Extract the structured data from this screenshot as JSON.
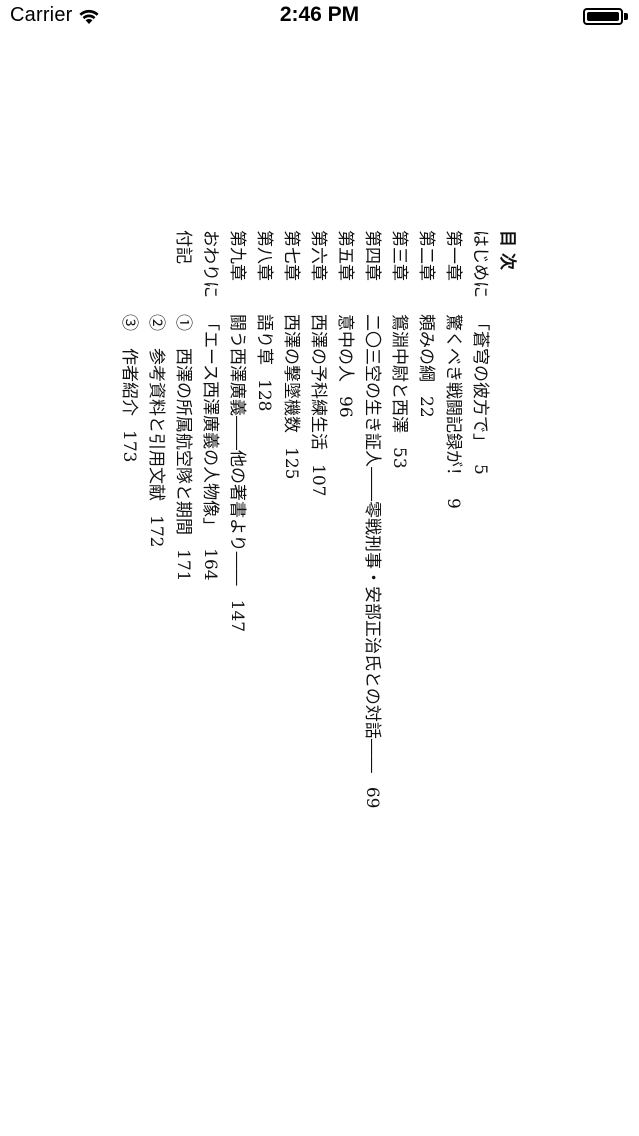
{
  "status_bar": {
    "carrier": "Carrier",
    "time": "2:46 PM"
  },
  "toc": {
    "title": "目次",
    "entries": [
      {
        "label": "はじめに",
        "text": "「蒼穹の彼方で」",
        "page": "5"
      },
      {
        "label": "第一章",
        "text": "驚くべき戦闘記録が！",
        "page": "9"
      },
      {
        "label": "第二章",
        "text": "頼みの綱",
        "page": "22"
      },
      {
        "label": "第三章",
        "text": "鴛淵中尉と西澤",
        "page": "53"
      },
      {
        "label": "第四章",
        "text": "二〇三空の生き証人――零戦刑事・安部正治氏との対話――",
        "page": "69"
      },
      {
        "label": "第五章",
        "text": "意中の人",
        "page": "96"
      },
      {
        "label": "第六章",
        "text": "西澤の予科練生活",
        "page": "107"
      },
      {
        "label": "第七章",
        "text": "西澤の撃墜機数",
        "page": "125"
      },
      {
        "label": "第八章",
        "text": "語り草",
        "page": "128"
      },
      {
        "label": "第九章",
        "text": "闘う西澤廣義――他の著書より――",
        "page": "147"
      },
      {
        "label": "おわりに",
        "text": "「エース西澤廣義の人物像」",
        "page": "164"
      },
      {
        "label": "付記",
        "text": "①　西澤の所属航空隊と期間",
        "page": "171"
      },
      {
        "label": "",
        "text": "②　参考資料と引用文献",
        "page": "172"
      },
      {
        "label": "",
        "text": "③　作者紹介",
        "page": "173"
      }
    ]
  }
}
